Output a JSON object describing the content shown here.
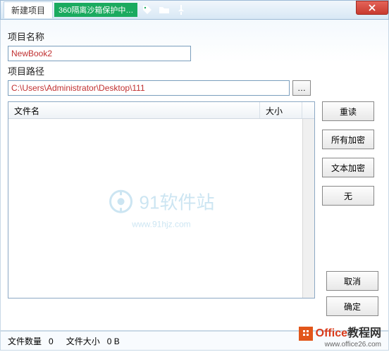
{
  "titlebar": {
    "title": "新建项目",
    "sandbox_tag": "360隔离沙箱保护中…"
  },
  "labels": {
    "project_name": "项目名称",
    "project_path": "项目路径"
  },
  "inputs": {
    "project_name_value": "NewBook2",
    "project_path_value": "C:\\Users\\Administrator\\Desktop\\111",
    "browse_label": "…"
  },
  "file_list": {
    "col_filename": "文件名",
    "col_size": "大小"
  },
  "buttons": {
    "reread": "重读",
    "encrypt_all": "所有加密",
    "encrypt_text": "文本加密",
    "none": "无",
    "cancel": "取消",
    "ok": "确定"
  },
  "status": {
    "file_count_label": "文件数量",
    "file_count_value": "0",
    "file_size_label": "文件大小",
    "file_size_value": "0 B"
  },
  "watermark": {
    "text": "91软件站",
    "url": "www.91hjz.com"
  },
  "branding": {
    "office": "Office",
    "suffix": "教程网",
    "url": "www.office26.com"
  }
}
